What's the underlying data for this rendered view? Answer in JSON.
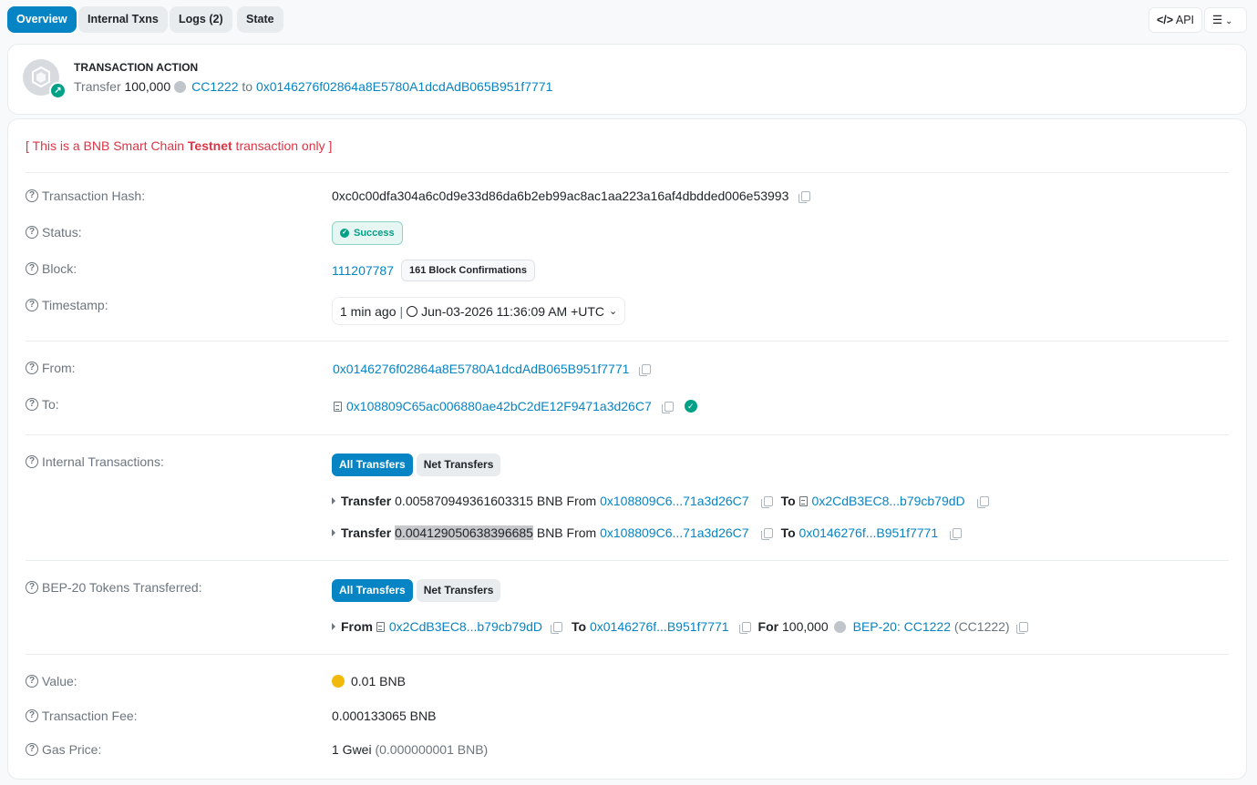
{
  "tabs": [
    "Overview",
    "Internal Txns",
    "Logs (2)",
    "State"
  ],
  "top_buttons": {
    "api": "API"
  },
  "action": {
    "heading": "TRANSACTION ACTION",
    "verb": "Transfer",
    "amount": "100,000",
    "token": "CC1222",
    "to_word": "to",
    "to_address": "0x0146276f02864a8E5780A1dcdAdB065B951f7771"
  },
  "testnet_notice": {
    "prefix": "[ This is a BNB Smart Chain ",
    "bold": "Testnet",
    "suffix": " transaction only ]"
  },
  "labels": {
    "hash": "Transaction Hash:",
    "status": "Status:",
    "block": "Block:",
    "timestamp": "Timestamp:",
    "from": "From:",
    "to": "To:",
    "internal": "Internal Transactions:",
    "bep20": "BEP-20 Tokens Transferred:",
    "value": "Value:",
    "fee": "Transaction Fee:",
    "gas": "Gas Price:"
  },
  "hash": "0xc0c00dfa304a6c0d9e33d86da6b2eb99ac8ac1aa223a16af4dbdded006e53993",
  "status": "Success",
  "block": {
    "number": "111207787",
    "confirmations": "161 Block Confirmations"
  },
  "timestamp": {
    "ago": "1 min ago",
    "sep": "|",
    "full": "Jun-03-2026 11:36:09 AM +UTC"
  },
  "from": "0x0146276f02864a8E5780A1dcdAdB065B951f7771",
  "to": "0x108809C65ac006880ae42bC2dE12F9471a3d26C7",
  "transfer_tabs": {
    "all": "All Transfers",
    "net": "Net Transfers"
  },
  "internal_transfers": [
    {
      "label": "Transfer",
      "amount": "0.005870949361603315",
      "unit": "BNB From",
      "from": "0x108809C6...71a3d26C7",
      "to_label": "To",
      "to": "0x2CdB3EC8...b79cb79dD"
    },
    {
      "label": "Transfer",
      "amount": "0.004129050638396685",
      "unit": "BNB From",
      "from": "0x108809C6...71a3d26C7",
      "to_label": "To",
      "to": "0x0146276f...B951f7771"
    }
  ],
  "token_transfer": {
    "from_label": "From",
    "from": "0x2CdB3EC8...b79cb79dD",
    "to_label": "To",
    "to": "0x0146276f...B951f7771",
    "for_label": "For",
    "amount": "100,000",
    "token": "BEP-20: CC1222",
    "symbol": "(CC1222)"
  },
  "value": "0.01 BNB",
  "fee": "0.000133065 BNB",
  "gas": {
    "main": "1 Gwei",
    "sub": "(0.000000001 BNB)"
  },
  "colors": {
    "accent": "#0784c3",
    "success": "#00a186",
    "danger": "#dc3545",
    "bnb": "#f0b90b"
  }
}
